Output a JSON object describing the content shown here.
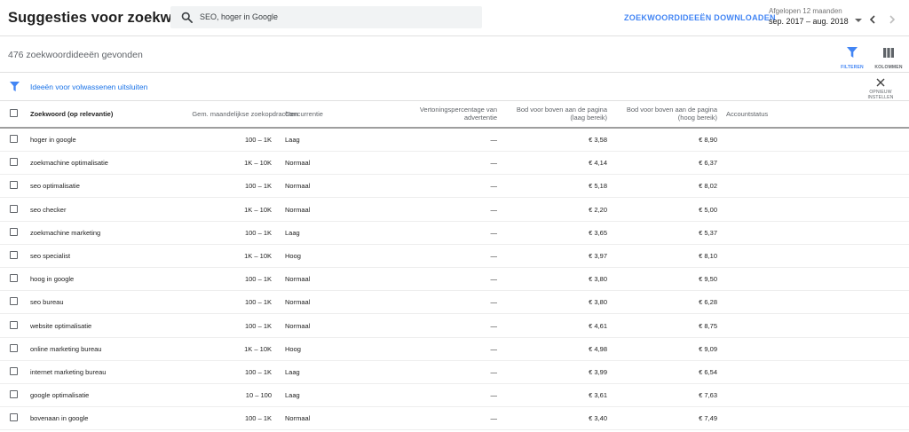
{
  "header": {
    "title": "Suggesties voor zoekwoorden",
    "search_value": "SEO, hoger in Google",
    "download_label": "ZOEKWOORDIDEEËN DOWNLOADEN",
    "date_label": "Afgelopen 12 maanden",
    "date_value": "sep. 2017 – aug. 2018"
  },
  "toolbar": {
    "count_text": "476 zoekwoordideeën gevonden",
    "filter_label": "FILTEREN",
    "columns_label": "KOLOMMEN"
  },
  "filter": {
    "text": "Ideeën voor volwassenen uitsluiten",
    "reset_label": "OPNIEUW INSTELLEN"
  },
  "table": {
    "headers": {
      "keyword": "Zoekwoord (op relevantie)",
      "volume": "Gem. maandelijkse zoekopdrachten",
      "competition": "Concurrentie",
      "impression_share_1": "Vertoningspercentage van",
      "impression_share_2": "advertentie",
      "bid_low_1": "Bod voor boven aan de pagina",
      "bid_low_2": "(laag bereik)",
      "bid_high_1": "Bod voor boven aan de pagina",
      "bid_high_2": "(hoog bereik)",
      "status": "Accountstatus"
    },
    "rows": [
      {
        "keyword": "hoger in google",
        "volume": "100 – 1K",
        "competition": "Laag",
        "share": "—",
        "low": "€ 3,58",
        "high": "€ 8,90"
      },
      {
        "keyword": "zoekmachine optimalisatie",
        "volume": "1K – 10K",
        "competition": "Normaal",
        "share": "—",
        "low": "€ 4,14",
        "high": "€ 6,37"
      },
      {
        "keyword": "seo optimalisatie",
        "volume": "100 – 1K",
        "competition": "Normaal",
        "share": "—",
        "low": "€ 5,18",
        "high": "€ 8,02"
      },
      {
        "keyword": "seo checker",
        "volume": "1K – 10K",
        "competition": "Normaal",
        "share": "—",
        "low": "€ 2,20",
        "high": "€ 5,00"
      },
      {
        "keyword": "zoekmachine marketing",
        "volume": "100 – 1K",
        "competition": "Laag",
        "share": "—",
        "low": "€ 3,65",
        "high": "€ 5,37"
      },
      {
        "keyword": "seo specialist",
        "volume": "1K – 10K",
        "competition": "Hoog",
        "share": "—",
        "low": "€ 3,97",
        "high": "€ 8,10"
      },
      {
        "keyword": "hoog in google",
        "volume": "100 – 1K",
        "competition": "Normaal",
        "share": "—",
        "low": "€ 3,80",
        "high": "€ 9,50"
      },
      {
        "keyword": "seo bureau",
        "volume": "100 – 1K",
        "competition": "Normaal",
        "share": "—",
        "low": "€ 3,80",
        "high": "€ 6,28"
      },
      {
        "keyword": "website optimalisatie",
        "volume": "100 – 1K",
        "competition": "Normaal",
        "share": "—",
        "low": "€ 4,61",
        "high": "€ 8,75"
      },
      {
        "keyword": "online marketing bureau",
        "volume": "1K – 10K",
        "competition": "Hoog",
        "share": "—",
        "low": "€ 4,98",
        "high": "€ 9,09"
      },
      {
        "keyword": "internet marketing bureau",
        "volume": "100 – 1K",
        "competition": "Laag",
        "share": "—",
        "low": "€ 3,99",
        "high": "€ 6,54"
      },
      {
        "keyword": "google optimalisatie",
        "volume": "10 – 100",
        "competition": "Laag",
        "share": "—",
        "low": "€ 3,61",
        "high": "€ 7,63"
      },
      {
        "keyword": "bovenaan in google",
        "volume": "100 – 1K",
        "competition": "Normaal",
        "share": "—",
        "low": "€ 3,40",
        "high": "€ 7,49"
      }
    ]
  },
  "colors": {
    "accent": "#4285f4",
    "link": "#1a73e8"
  },
  "icons": {
    "search": "search-icon",
    "filter": "filter-icon",
    "columns": "columns-icon",
    "close": "close-icon",
    "prev": "chevron-left-icon",
    "next": "chevron-right-icon",
    "dropdown": "dropdown-arrow-icon"
  }
}
